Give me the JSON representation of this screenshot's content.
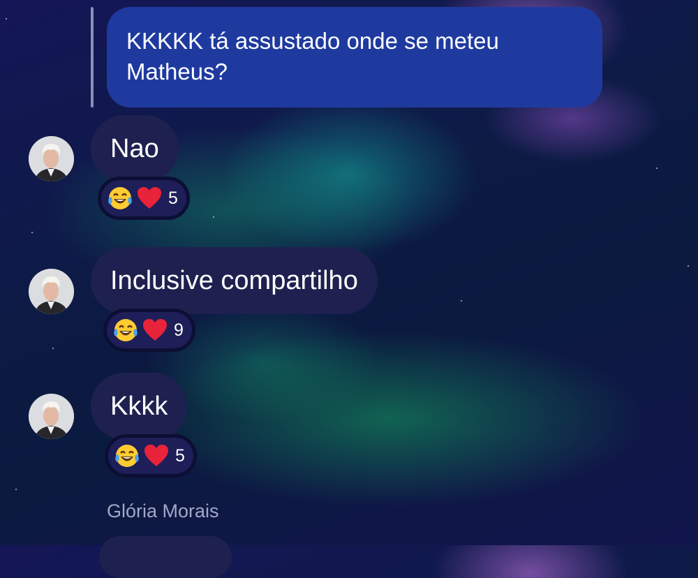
{
  "thread": {
    "sent_message": "KKKKK tá assustado onde se meteu Matheus?"
  },
  "messages": [
    {
      "text": "Nao",
      "reactions": {
        "emoji_1": "laughing-tears",
        "emoji_2": "red-heart",
        "count": "5"
      }
    },
    {
      "text": "Inclusive compartilho",
      "reactions": {
        "emoji_1": "laughing-tears",
        "emoji_2": "red-heart",
        "count": "9"
      }
    },
    {
      "text": "Kkkk",
      "reactions": {
        "emoji_1": "laughing-tears",
        "emoji_2": "red-heart",
        "count": "5"
      }
    }
  ],
  "next_sender": {
    "name": "Glória Morais"
  },
  "colors": {
    "sent_bubble": "#1f3a9f",
    "received_bubble": "#1e2150",
    "reaction_pill": "#1e1e58",
    "sender_name": "#a3a8c8"
  }
}
